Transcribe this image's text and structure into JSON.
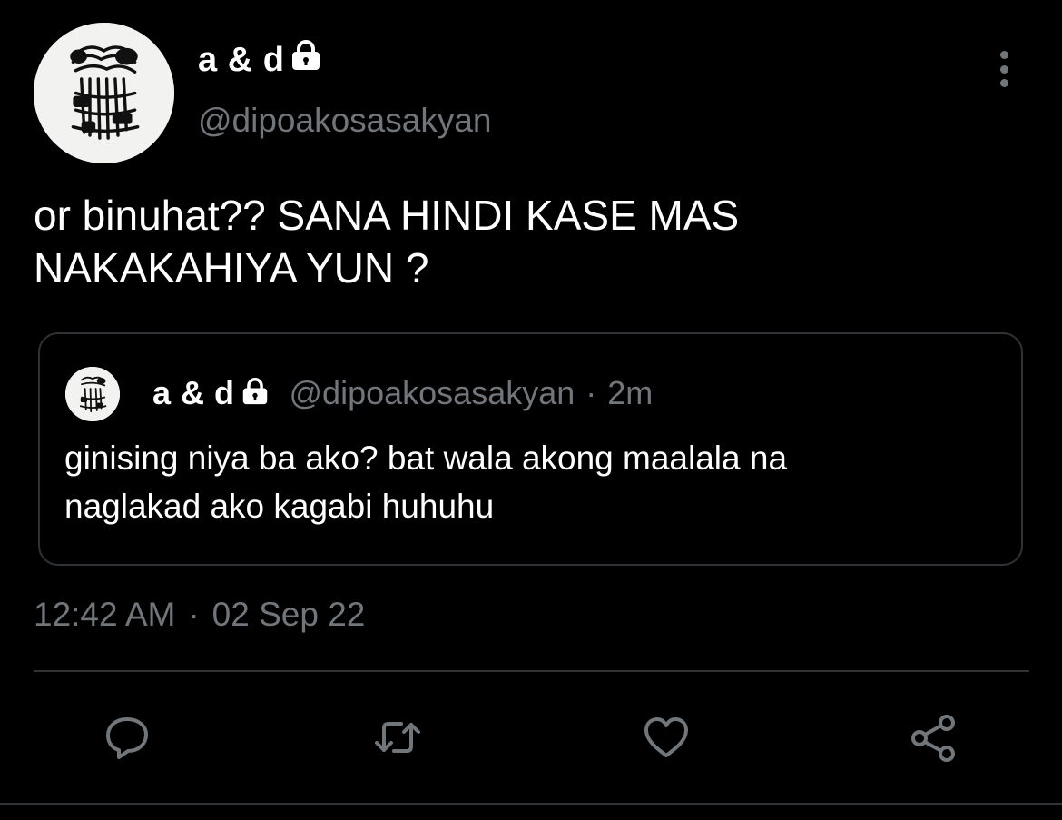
{
  "tweet": {
    "author": {
      "display_name": "a & d",
      "handle": "@dipoakosasakyan",
      "protected_icon": "lock-icon",
      "avatar_icon": "avatar-sketch"
    },
    "text_line1": "or binuhat?? SANA HINDI KASE MAS",
    "text_line2": "NAKAKAHIYA YUN ?",
    "quote": {
      "display_name": "a & d",
      "handle": "@dipoakosasakyan",
      "separator": "·",
      "time_ago": "2m",
      "text_line1": "ginising niya ba ako? bat wala akong maalala na",
      "text_line2": "naglakad ako kagabi huhuhu"
    },
    "time": "12:42 AM",
    "separator": "·",
    "date": "02 Sep 22"
  },
  "menu": {
    "icon": "more-vertical-icon"
  },
  "actions": [
    {
      "name": "reply",
      "icon": "reply-icon"
    },
    {
      "name": "retweet",
      "icon": "retweet-icon"
    },
    {
      "name": "like",
      "icon": "heart-icon"
    },
    {
      "name": "share",
      "icon": "share-icon"
    }
  ],
  "colors": {
    "background": "#000000",
    "text_primary": "#ffffff",
    "text_secondary": "#71767b",
    "border": "#2f3336"
  }
}
